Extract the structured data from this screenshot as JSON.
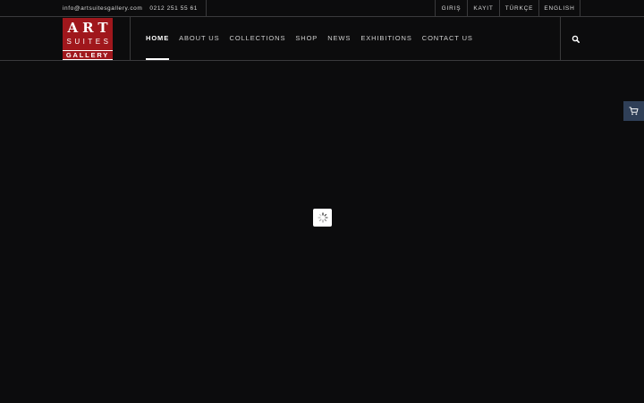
{
  "topbar": {
    "email": "info@artsuitesgallery.com",
    "phone": "0212 251 55 61",
    "links": [
      {
        "label": "GIRIŞ"
      },
      {
        "label": "KAYIT"
      },
      {
        "label": "TÜRKÇE"
      },
      {
        "label": "ENGLISH"
      }
    ]
  },
  "logo": {
    "line1": "ART",
    "line2": "SUITES",
    "line3": "GALLERY",
    "red": "#a0171c"
  },
  "nav": {
    "items": [
      {
        "label": "HOME",
        "active": true
      },
      {
        "label": "ABOUT US"
      },
      {
        "label": "COLLECTIONS"
      },
      {
        "label": "SHOP"
      },
      {
        "label": "NEWS"
      },
      {
        "label": "EXHIBITIONS"
      },
      {
        "label": "CONTACT US"
      }
    ],
    "search_icon": "search-icon"
  },
  "cart": {
    "icon": "cart-icon",
    "color": "#2f3f57"
  },
  "loader": {
    "icon": "spinner-icon"
  }
}
